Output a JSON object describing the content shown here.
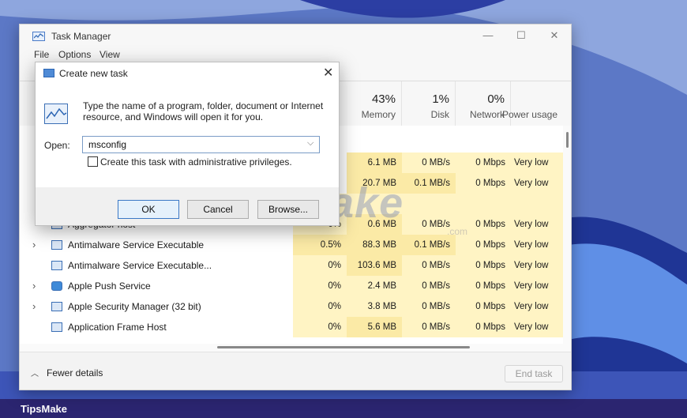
{
  "window": {
    "title": "Task Manager",
    "minimize": "—",
    "maximize": "☐",
    "close": "✕"
  },
  "menu": [
    "File",
    "Options",
    "View"
  ],
  "columns": [
    {
      "pct": "43%",
      "label": "Memory"
    },
    {
      "pct": "1%",
      "label": "Disk"
    },
    {
      "pct": "0%",
      "label": "Network"
    },
    {
      "pct": "",
      "label": "Power usage"
    }
  ],
  "rows": [
    {
      "expandable": false,
      "name": "",
      "cpu": "",
      "memory": "6.1 MB",
      "disk": "0 MB/s",
      "network": "0 Mbps",
      "power": "Very low"
    },
    {
      "expandable": false,
      "name": "",
      "cpu": "",
      "memory": "20.7 MB",
      "disk": "0.1 MB/s",
      "network": "0 Mbps",
      "power": "Very low"
    },
    {
      "expandable": false,
      "name": "",
      "cpu": "",
      "memory": "",
      "disk": "",
      "network": "",
      "power": ""
    },
    {
      "expandable": false,
      "name": "Aggregator host",
      "cpu": "0%",
      "memory": "0.6 MB",
      "disk": "0 MB/s",
      "network": "0 Mbps",
      "power": "Very low"
    },
    {
      "expandable": true,
      "name": "Antimalware Service Executable",
      "cpu": "0.5%",
      "memory": "88.3 MB",
      "disk": "0.1 MB/s",
      "network": "0 Mbps",
      "power": "Very low"
    },
    {
      "expandable": false,
      "name": "Antimalware Service Executable...",
      "cpu": "0%",
      "memory": "103.6 MB",
      "disk": "0 MB/s",
      "network": "0 Mbps",
      "power": "Very low"
    },
    {
      "expandable": true,
      "name": "Apple Push Service",
      "cpu": "0%",
      "memory": "2.4 MB",
      "disk": "0 MB/s",
      "network": "0 Mbps",
      "power": "Very low"
    },
    {
      "expandable": true,
      "name": "Apple Security Manager (32 bit)",
      "cpu": "0%",
      "memory": "3.8 MB",
      "disk": "0 MB/s",
      "network": "0 Mbps",
      "power": "Very low"
    },
    {
      "expandable": false,
      "name": "Application Frame Host",
      "cpu": "0%",
      "memory": "5.6 MB",
      "disk": "0 MB/s",
      "network": "0 Mbps",
      "power": "Very low"
    }
  ],
  "footer": {
    "fewer_details": "Fewer details",
    "end_task": "End task"
  },
  "dialog": {
    "title": "Create new task",
    "close": "✕",
    "description": "Type the name of a program, folder, document or Internet resource, and Windows will open it for you.",
    "open_label": "Open:",
    "open_value": "msconfig",
    "admin_checkbox_label": "Create this task with administrative privileges.",
    "ok": "OK",
    "cancel": "Cancel",
    "browse": "Browse..."
  },
  "watermark": {
    "text": "TipsMake",
    "sub": ".com"
  },
  "brand_bar": "TipsMake"
}
